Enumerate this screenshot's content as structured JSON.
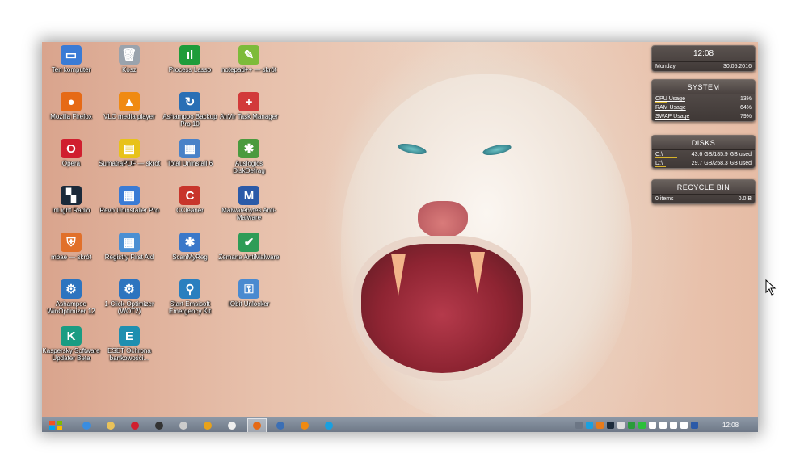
{
  "desktop_icons": [
    {
      "label": "Ten komputer",
      "icon": "computer-icon",
      "color": "#3a7bd5",
      "glyph": "▭"
    },
    {
      "label": "Kosz",
      "icon": "recycle-bin-icon",
      "color": "#9aa3ad",
      "glyph": "🗑"
    },
    {
      "label": "Process Lasso",
      "icon": "process-lasso-icon",
      "color": "#1e9c3a",
      "glyph": "ıl"
    },
    {
      "label": "notepad++ — skrót",
      "icon": "notepad-plus-icon",
      "color": "#7dbb3a",
      "glyph": "✎"
    },
    {
      "label": "Mozilla Firefox",
      "icon": "firefox-icon",
      "color": "#e66a16",
      "glyph": "●"
    },
    {
      "label": "VLC media player",
      "icon": "vlc-icon",
      "color": "#f08a12",
      "glyph": "▲"
    },
    {
      "label": "Ashampoo Backup Pro 10",
      "icon": "ashampoo-backup-icon",
      "color": "#2a6fb5",
      "glyph": "↻"
    },
    {
      "label": "AnVir Task Manager",
      "icon": "anvir-icon",
      "color": "#d23a3a",
      "glyph": "+"
    },
    {
      "label": "Opera",
      "icon": "opera-icon",
      "color": "#d01f2f",
      "glyph": "O"
    },
    {
      "label": "SumatraPDF — skrót",
      "icon": "sumatra-pdf-icon",
      "color": "#e8c21a",
      "glyph": "▤"
    },
    {
      "label": "Total Uninstall 6",
      "icon": "total-uninstall-icon",
      "color": "#4a82c8",
      "glyph": "▦"
    },
    {
      "label": "Auslogics DiskDefrag",
      "icon": "diskdefrag-icon",
      "color": "#4a9a3e",
      "glyph": "✱"
    },
    {
      "label": "inLight Radio",
      "icon": "radio-icon",
      "color": "#1b2a3a",
      "glyph": "▚"
    },
    {
      "label": "Revo Uninstaller Pro",
      "icon": "revo-uninstaller-icon",
      "color": "#3a7bd5",
      "glyph": "▦"
    },
    {
      "label": "CCleaner",
      "icon": "ccleaner-icon",
      "color": "#c8352b",
      "glyph": "C"
    },
    {
      "label": "Malwarebytes Anti-Malware",
      "icon": "malwarebytes-icon",
      "color": "#2b5aa8",
      "glyph": "M"
    },
    {
      "label": "mbae — skrót",
      "icon": "mbae-icon",
      "color": "#e1702a",
      "glyph": "⛨"
    },
    {
      "label": "Registry First Aid",
      "icon": "registry-icon",
      "color": "#4b8fd3",
      "glyph": "▦"
    },
    {
      "label": "ScanMyReg",
      "icon": "scanmyreg-icon",
      "color": "#3b78c9",
      "glyph": "✱"
    },
    {
      "label": "Zemana AntiMalware",
      "icon": "zemana-icon",
      "color": "#2e9c57",
      "glyph": "✔"
    },
    {
      "label": "Ashampoo WinOptimizer 12",
      "icon": "winoptimizer-icon",
      "color": "#2d74bf",
      "glyph": "⚙"
    },
    {
      "label": "1-Click-Optimizer (WOT2)",
      "icon": "optimizer-icon",
      "color": "#2d74bf",
      "glyph": "⚙"
    },
    {
      "label": "Start Emsisoft Emergency Kit",
      "icon": "emsisoft-icon",
      "color": "#2a7fbf",
      "glyph": "⚲"
    },
    {
      "label": "IObit Unlocker",
      "icon": "unlocker-icon",
      "color": "#4a8ad0",
      "glyph": "⚿"
    },
    {
      "label": "Kaspersky Software Updater Beta",
      "icon": "kaspersky-icon",
      "color": "#1a9c82",
      "glyph": "K"
    },
    {
      "label": "ESET Ochrona bankowości...",
      "icon": "eset-icon",
      "color": "#1f8fb0",
      "glyph": "E"
    }
  ],
  "gadgets": {
    "clock": {
      "time": "12:08",
      "day": "Monday",
      "date": "30.05.2016"
    },
    "system": {
      "title": "SYSTEM",
      "rows": [
        {
          "label": "CPU Usage",
          "value": "13%",
          "level": 0.13
        },
        {
          "label": "RAM Usage",
          "value": "64%",
          "level": 0.64
        },
        {
          "label": "SWAP Usage",
          "value": "79%",
          "level": 0.79
        }
      ]
    },
    "disks": {
      "title": "DISKS",
      "rows": [
        {
          "label": "C:\\",
          "value": "43.6 GB/185.9 GB used",
          "level": 0.23
        },
        {
          "label": "D:\\",
          "value": "29.7 GB/258.3 GB used",
          "level": 0.11
        }
      ]
    },
    "recycle": {
      "title": "RECYCLE BIN",
      "items": "0 items",
      "size": "0.0 B"
    }
  },
  "taskbar": {
    "start_icon": "windows-start-icon",
    "pinned": [
      {
        "icon": "ie-icon",
        "color": "#3a8de0"
      },
      {
        "icon": "explorer-icon",
        "color": "#e9c25a"
      },
      {
        "icon": "opera-icon",
        "color": "#d01f2f"
      },
      {
        "icon": "chat-icon",
        "color": "#333333"
      },
      {
        "icon": "media-icon",
        "color": "#cccccc"
      },
      {
        "icon": "sumatra-icon",
        "color": "#e8a21a"
      },
      {
        "icon": "drop-icon",
        "color": "#eeeeee"
      },
      {
        "icon": "firefox-icon",
        "color": "#e66a16",
        "active": true
      },
      {
        "icon": "thunderbird-icon",
        "color": "#3b6fb5"
      },
      {
        "icon": "notes-icon",
        "color": "#f08a12"
      },
      {
        "icon": "skype-icon",
        "color": "#1aa0e0"
      }
    ],
    "tray": [
      {
        "icon": "tray-arrow-icon",
        "color": "#6c7685"
      },
      {
        "icon": "tray-skype-icon",
        "color": "#1aa0e0"
      },
      {
        "icon": "tray-avast-icon",
        "color": "#e87b1a"
      },
      {
        "icon": "tray-monitor-icon",
        "color": "#1b2a3a"
      },
      {
        "icon": "tray-drop-icon",
        "color": "#dddddd"
      },
      {
        "icon": "tray-green-icon",
        "color": "#2a9c3a"
      },
      {
        "icon": "tray-circle-icon",
        "color": "#2bbf3a"
      },
      {
        "icon": "tray-flag-icon",
        "color": "#ffffff"
      },
      {
        "icon": "tray-network-icon",
        "color": "#ffffff"
      },
      {
        "icon": "tray-signal-icon",
        "color": "#ffffff"
      },
      {
        "icon": "tray-volume-icon",
        "color": "#ffffff"
      },
      {
        "icon": "tray-malwarebytes-icon",
        "color": "#2b5aa8"
      }
    ],
    "clock": "12:08"
  }
}
